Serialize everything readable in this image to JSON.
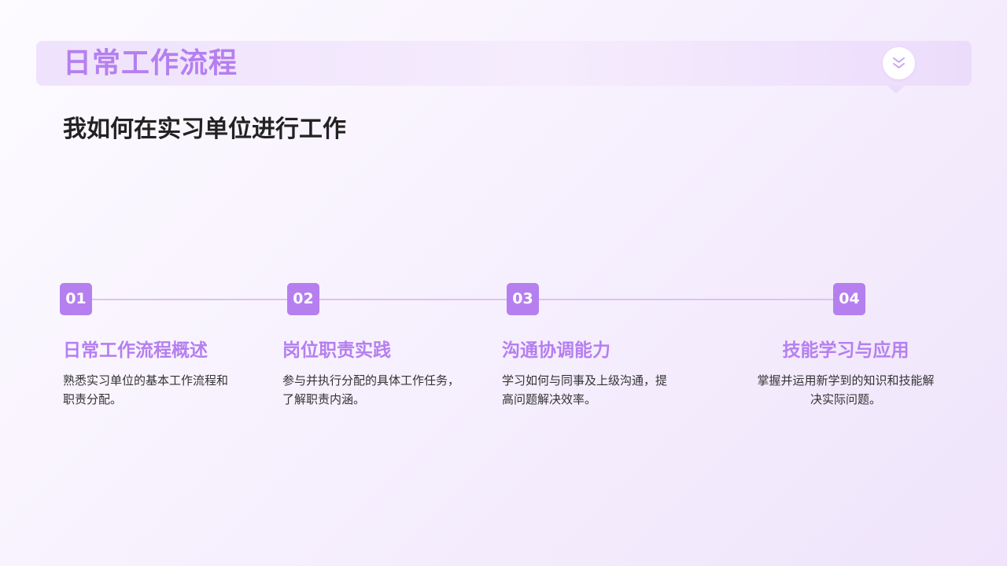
{
  "header": {
    "title": "日常工作流程",
    "icon": "double-chevron-down-icon"
  },
  "subtitle": "我如何在实习单位进行工作",
  "colors": {
    "accent": "#b57ff0",
    "timeline": "#dcc2f5",
    "text": "#333333",
    "heading": "#222222"
  },
  "steps": [
    {
      "number": "01",
      "title": "日常工作流程概述",
      "desc_line1": "熟悉实习单位的基本工作流程和",
      "desc_line2": "职责分配。"
    },
    {
      "number": "02",
      "title": "岗位职责实践",
      "desc_line1": "参与并执行分配的具体工作任务，",
      "desc_line2": "了解职责内涵。"
    },
    {
      "number": "03",
      "title": "沟通协调能力",
      "desc_line1": "学习如何与同事及上级沟通，提",
      "desc_line2": "高问题解决效率。"
    },
    {
      "number": "04",
      "title": "技能学习与应用",
      "desc_line1": "掌握并运用新学到的知识和技能解",
      "desc_line2": "决实际问题。"
    }
  ]
}
